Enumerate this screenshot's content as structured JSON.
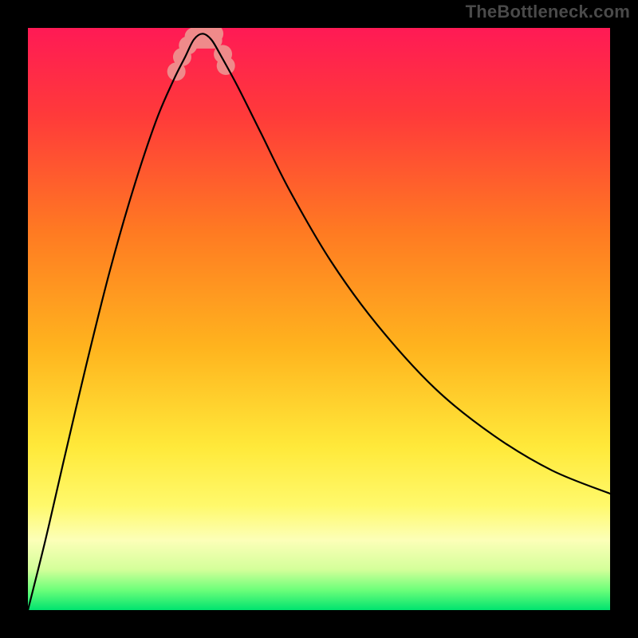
{
  "attribution": "TheBottleneck.com",
  "chart_data": {
    "type": "line",
    "title": "",
    "xlabel": "",
    "ylabel": "",
    "xlim": [
      0,
      1
    ],
    "ylim": [
      0,
      1
    ],
    "legend": false,
    "grid": false,
    "background_gradient": {
      "type": "vertical",
      "stops": [
        {
          "pos": 0.0,
          "color": "#ff1a55"
        },
        {
          "pos": 0.15,
          "color": "#ff3a3a"
        },
        {
          "pos": 0.35,
          "color": "#ff7a22"
        },
        {
          "pos": 0.55,
          "color": "#ffb41e"
        },
        {
          "pos": 0.72,
          "color": "#ffe93a"
        },
        {
          "pos": 0.82,
          "color": "#fff96b"
        },
        {
          "pos": 0.88,
          "color": "#fcffb8"
        },
        {
          "pos": 0.93,
          "color": "#d4ff9a"
        },
        {
          "pos": 0.965,
          "color": "#6eff7a"
        },
        {
          "pos": 1.0,
          "color": "#00e36f"
        }
      ]
    },
    "bottleneck_band": {
      "y0": 0.95,
      "y1": 0.99
    },
    "optimum_x": 0.3,
    "series": [
      {
        "name": "bottleneck-curve",
        "x": [
          0.0,
          0.03,
          0.06,
          0.1,
          0.14,
          0.18,
          0.22,
          0.25,
          0.27,
          0.285,
          0.3,
          0.315,
          0.33,
          0.36,
          0.4,
          0.45,
          0.52,
          0.6,
          0.7,
          0.8,
          0.9,
          1.0
        ],
        "y": [
          0.0,
          0.12,
          0.25,
          0.42,
          0.58,
          0.72,
          0.84,
          0.91,
          0.95,
          0.98,
          0.99,
          0.98,
          0.955,
          0.9,
          0.82,
          0.72,
          0.6,
          0.49,
          0.38,
          0.3,
          0.24,
          0.2
        ]
      }
    ],
    "pink_blob_points": [
      {
        "x": 0.255,
        "y": 0.925
      },
      {
        "x": 0.265,
        "y": 0.95
      },
      {
        "x": 0.275,
        "y": 0.97
      },
      {
        "x": 0.285,
        "y": 0.985
      },
      {
        "x": 0.3,
        "y": 0.99
      },
      {
        "x": 0.32,
        "y": 0.99
      },
      {
        "x": 0.335,
        "y": 0.955
      },
      {
        "x": 0.34,
        "y": 0.935
      }
    ]
  }
}
